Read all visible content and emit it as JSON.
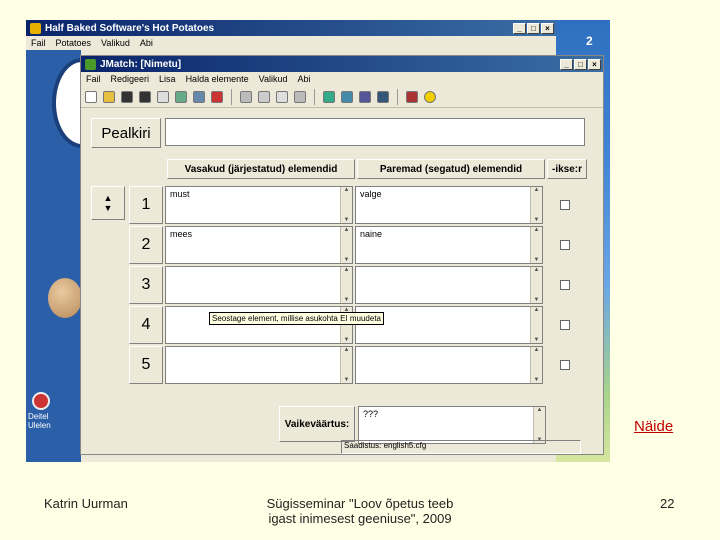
{
  "back_window": {
    "title": "Half Baked Software's Hot Potatoes",
    "menu": [
      "Fail",
      "Potatoes",
      "Valikud",
      "Abi"
    ],
    "side_number": "2",
    "desktop_icon_label": "Deitel Ulelen"
  },
  "jmatch": {
    "title": "JMatch: [Nimetu]",
    "menu": [
      "Fail",
      "Redigeeri",
      "Lisa",
      "Halda elemente",
      "Valikud",
      "Abi"
    ],
    "title_label": "Pealkiri",
    "title_value": "",
    "col_left": "Vasakud (järjestatud) elemendid",
    "col_right": "Paremad (segatud) elemendid",
    "col_fix": "-ikse:r",
    "rows": [
      {
        "num": "1",
        "left": "must",
        "right": "valge"
      },
      {
        "num": "2",
        "left": "mees",
        "right": "naine"
      },
      {
        "num": "3",
        "left": "",
        "right": ""
      },
      {
        "num": "4",
        "left": "",
        "right": ""
      },
      {
        "num": "5",
        "left": "",
        "right": ""
      }
    ],
    "tooltip": "Seostage element, millise asukohta EI muudeta",
    "default_label": "Vaikeväärtus:",
    "default_value": "???",
    "status": "Saadistus: english5.cfg"
  },
  "slide": {
    "link": "Näide",
    "author": "Katrin Uurman",
    "seminar_line1": "Sügisseminar \"Loov õpetus teeb",
    "seminar_line2": "igast inimesest geeniuse\", 2009",
    "page_number": "22"
  }
}
